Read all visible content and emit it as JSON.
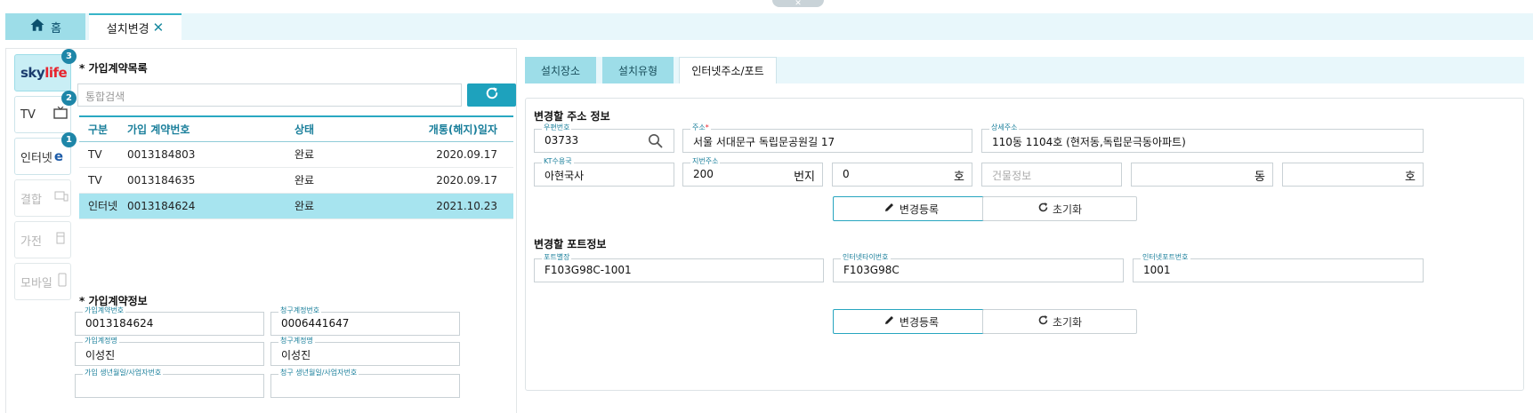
{
  "tabs": {
    "home_label": "홈",
    "active_label": "설치변경"
  },
  "side_nav": [
    {
      "label": "skylife",
      "badge": "3"
    },
    {
      "label": "TV",
      "badge": "2"
    },
    {
      "label": "인터넷",
      "badge": "1"
    },
    {
      "label": "결합"
    },
    {
      "label": "가전"
    },
    {
      "label": "모바일"
    }
  ],
  "contract_list": {
    "title": "* 가입계약목록",
    "search_placeholder": "통합검색",
    "columns": [
      "구분",
      "가입 계약번호",
      "상태",
      "개통(해지)일자"
    ],
    "rows": [
      {
        "type": "TV",
        "number": "0013184803",
        "status": "완료",
        "date": "2020.09.17"
      },
      {
        "type": "TV",
        "number": "0013184635",
        "status": "완료",
        "date": "2020.09.17"
      },
      {
        "type": "인터넷",
        "number": "0013184624",
        "status": "완료",
        "date": "2021.10.23"
      }
    ]
  },
  "contract_info": {
    "title": "* 가입계약정보",
    "fields": [
      {
        "label": "가입계약번호",
        "value": "0013184624"
      },
      {
        "label": "청구계정번호",
        "value": "0006441647"
      },
      {
        "label": "가입계정명",
        "value": "이성진"
      },
      {
        "label": "청구계정명",
        "value": "이성진"
      },
      {
        "label": "가입 생년월일/사업자번호",
        "value": ""
      },
      {
        "label": "청구 생년월일/사업자번호",
        "value": ""
      }
    ]
  },
  "sub_tabs": [
    "설치장소",
    "설치유형",
    "인터넷주소/포트"
  ],
  "address_section": {
    "title": "변경할 주소 정보",
    "zip_label": "우편번호",
    "zip": "03733",
    "addr_label": "주소",
    "addr": "서울 서대문구 독립문공원길 17",
    "detail_label": "상세주소",
    "detail": "110동 1104호 (현저동,독립문극동아파트)",
    "kt_label": "KT수용국",
    "kt": "아현국사",
    "lot_label": "지번주소",
    "lot": "200",
    "lot_suffix": "번지",
    "ho_value": "0",
    "ho_suffix": "호",
    "building_placeholder": "건물정보",
    "dong_suffix": "동",
    "ho2_suffix": "호"
  },
  "port_section": {
    "title": "변경할 포트정보",
    "port_label": "포트별장",
    "port": "F103G98C-1001",
    "tie_label": "인터넷타이번호",
    "tie": "F103G98C",
    "port_no_label": "인터넷포트번호",
    "port_no": "1001"
  },
  "buttons": {
    "register": "변경등록",
    "reset": "초기화"
  },
  "colors": {
    "accent": "#1ea2bd",
    "selected_row": "#a7e4ef",
    "tab_bg": "#9ddde8"
  }
}
